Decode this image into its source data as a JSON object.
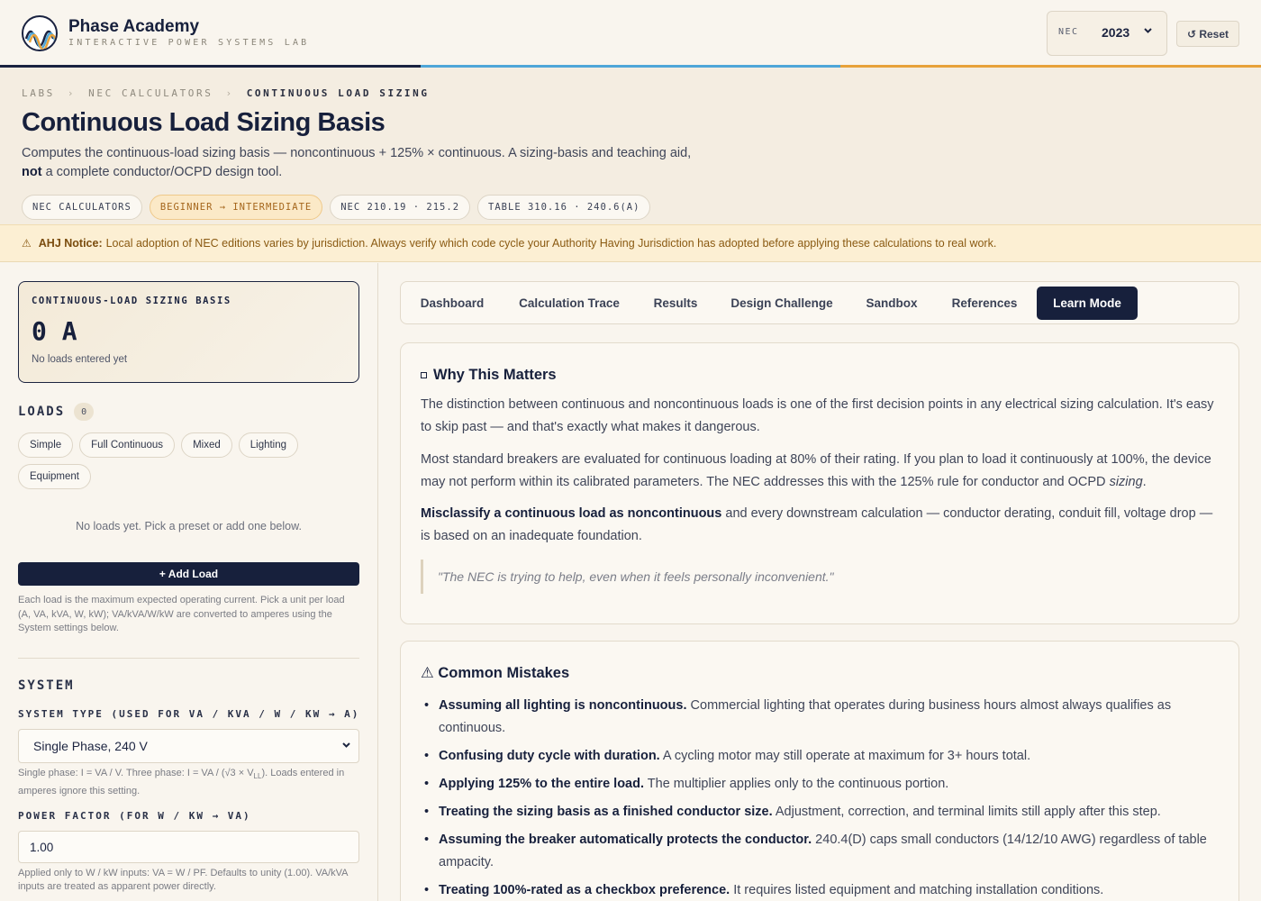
{
  "header": {
    "brand_name": "Phase Academy",
    "brand_subtitle": "INTERACTIVE POWER SYSTEMS LAB",
    "nec_label": "NEC",
    "nec_year": "2023",
    "reset_label": "↺ Reset"
  },
  "accent_colors": {
    "navy": "#1a2240",
    "blue": "#4fa6d8",
    "orange": "#e8a23a"
  },
  "breadcrumb": [
    "LABS",
    "NEC CALCULATORS",
    "CONTINUOUS LOAD SIZING"
  ],
  "page": {
    "title": "Continuous Load Sizing Basis",
    "description_part1": "Computes the continuous-load sizing basis — noncontinuous + 125% × continuous. A sizing-basis and teaching aid,",
    "description_bold": "not",
    "description_part2": " a complete conductor/OCPD design tool."
  },
  "tags": [
    "NEC CALCULATORS",
    "BEGINNER → INTERMEDIATE",
    "NEC 210.19 · 215.2",
    "TABLE 310.16 · 240.6(A)"
  ],
  "notice": {
    "icon": "⚠",
    "label": "AHJ Notice:",
    "text": "Local adoption of NEC editions varies by jurisdiction. Always verify which code cycle your Authority Having Jurisdiction has adopted before applying these calculations to real work."
  },
  "sidebar": {
    "basis_label": "CONTINUOUS-LOAD SIZING BASIS",
    "basis_value": "0 A",
    "basis_note": "No loads entered yet",
    "loads_title": "LOADS",
    "loads_count": "0",
    "presets": [
      "Simple",
      "Full Continuous",
      "Mixed",
      "Lighting",
      "Equipment"
    ],
    "empty_text": "No loads yet. Pick a preset or add one below.",
    "add_load_label": "+ Add Load",
    "load_help": "Each load is the maximum expected operating current. Pick a unit per load (A, VA, kVA, W, kW); VA/kVA/W/kW are converted to amperes using the System settings below.",
    "system_title": "SYSTEM",
    "system_type_label": "SYSTEM TYPE (USED FOR VA / KVA / W / KW → A)",
    "system_type_value": "Single Phase, 240 V",
    "system_help_1": "Single phase: I = VA / V. Three phase: I = VA / (√3 × V",
    "system_help_sub": "LL",
    "system_help_2": "). Loads entered in amperes ignore this setting.",
    "pf_label": "POWER FACTOR (FOR W / KW → VA)",
    "pf_value": "1.00",
    "pf_help": "Applied only to W / kW inputs: VA = W / PF. Defaults to unity (1.00). VA/kVA inputs are treated as apparent power directly."
  },
  "tabs": [
    "Dashboard",
    "Calculation Trace",
    "Results",
    "Design Challenge",
    "Sandbox",
    "References",
    "Learn Mode"
  ],
  "active_tab": "Learn Mode",
  "why": {
    "title": "Why This Matters",
    "p1": "The distinction between continuous and noncontinuous loads is one of the first decision points in any electrical sizing calculation. It's easy to skip past — and that's exactly what makes it dangerous.",
    "p2_a": "Most standard breakers are evaluated for continuous loading at 80% of their rating. If you plan to load it continuously at 100%, the device may not perform within its calibrated parameters. The NEC addresses this with the 125% rule for conductor and OCPD ",
    "p2_em": "sizing",
    "p2_b": ".",
    "p3_bold": "Misclassify a continuous load as noncontinuous",
    "p3_rest": " and every downstream calculation — conductor derating, conduit fill, voltage drop — is based on an inadequate foundation.",
    "quote": "\"The NEC is trying to help, even when it feels personally inconvenient.\""
  },
  "mistakes": {
    "title": "⚠ Common Mistakes",
    "items": [
      {
        "bold": "Assuming all lighting is noncontinuous.",
        "text": " Commercial lighting that operates during business hours almost always qualifies as continuous."
      },
      {
        "bold": "Confusing duty cycle with duration.",
        "text": " A cycling motor may still operate at maximum for 3+ hours total."
      },
      {
        "bold": "Applying 125% to the entire load.",
        "text": " The multiplier applies only to the continuous portion."
      },
      {
        "bold": "Treating the sizing basis as a finished conductor size.",
        "text": " Adjustment, correction, and terminal limits still apply after this step."
      },
      {
        "bold": "Assuming the breaker automatically protects the conductor.",
        "text": " 240.4(D) caps small conductors (14/12/10 AWG) regardless of table ampacity."
      },
      {
        "bold": "Treating 100%-rated as a checkbox preference.",
        "text": " It requires listed equipment and matching installation conditions."
      }
    ]
  }
}
